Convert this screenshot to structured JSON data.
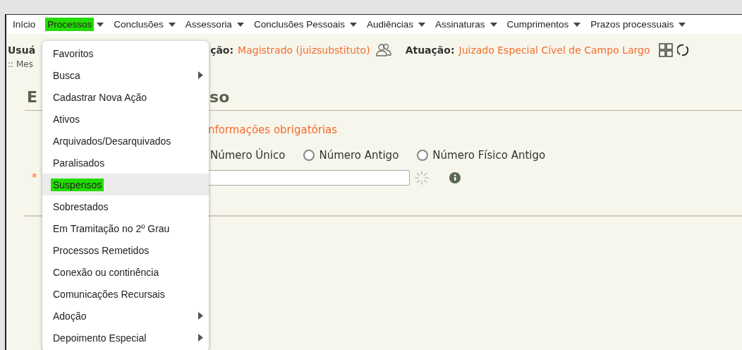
{
  "menubar": [
    {
      "label": "Início",
      "dropdown": false,
      "selected": false
    },
    {
      "label": "Processos",
      "dropdown": true,
      "selected": true
    },
    {
      "label": "Conclusões",
      "dropdown": true,
      "selected": false
    },
    {
      "label": "Assessoria",
      "dropdown": true,
      "selected": false
    },
    {
      "label": "Conclusões Pessoais",
      "dropdown": true,
      "selected": false
    },
    {
      "label": "Audiências",
      "dropdown": true,
      "selected": false
    },
    {
      "label": "Assinaturas",
      "dropdown": true,
      "selected": false
    },
    {
      "label": "Cumprimentos",
      "dropdown": true,
      "selected": false
    },
    {
      "label": "Prazos processuais",
      "dropdown": true,
      "selected": false
    }
  ],
  "info": {
    "user_label": "Usuá",
    "role_label": "ção:",
    "role_value": "Magistrado (juizsubstituto)",
    "unit_label": "Atuação:",
    "unit_value": "Juizado Especial Cível de Campo Largo"
  },
  "breadcrumb": ":: Mes",
  "heading": {
    "start": "E",
    "end": "so"
  },
  "required_note": "nformações obrigatórias",
  "search_type": {
    "first_label": "Número Único",
    "radios": [
      {
        "label": "Número Antigo",
        "selected": false
      },
      {
        "label": "Número Físico Antigo",
        "selected": false
      }
    ]
  },
  "required_mark": "*",
  "menu": [
    {
      "label": "Favoritos",
      "submenu": false,
      "selected": false
    },
    {
      "label": "Busca",
      "submenu": true,
      "selected": false
    },
    {
      "label": "Cadastrar Nova Ação",
      "submenu": false,
      "selected": false
    },
    {
      "label": "Ativos",
      "submenu": false,
      "selected": false
    },
    {
      "label": "Arquivados/Desarquivados",
      "submenu": false,
      "selected": false
    },
    {
      "label": "Paralisados",
      "submenu": false,
      "selected": false
    },
    {
      "label": "Suspensos",
      "submenu": false,
      "selected": true
    },
    {
      "label": "Sobrestados",
      "submenu": false,
      "selected": false
    },
    {
      "label": "Em Tramitação no 2º Grau",
      "submenu": false,
      "selected": false
    },
    {
      "label": "Processos Remetidos",
      "submenu": false,
      "selected": false
    },
    {
      "label": "Conexão ou continência",
      "submenu": false,
      "selected": false
    },
    {
      "label": "Comunicações Recursais",
      "submenu": false,
      "selected": false
    },
    {
      "label": "Adoção",
      "submenu": true,
      "selected": false
    },
    {
      "label": "Depoimento Especial",
      "submenu": true,
      "selected": false
    }
  ]
}
